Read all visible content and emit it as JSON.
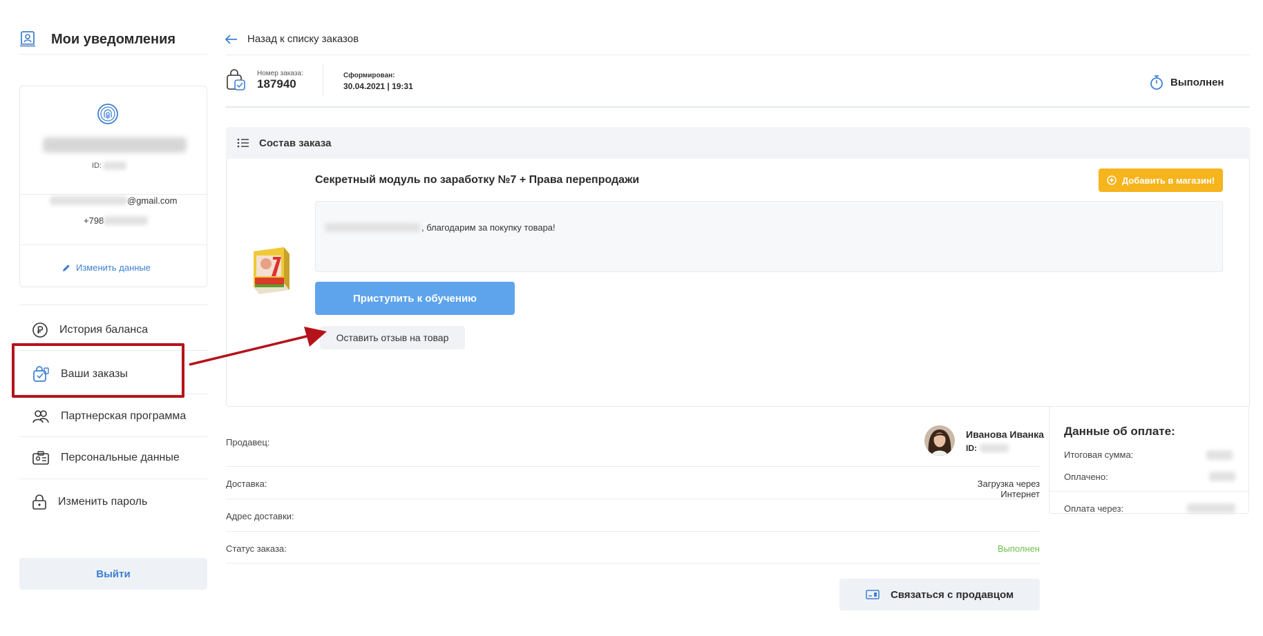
{
  "sidebar": {
    "notifications_title": "Мои уведомления",
    "profile": {
      "id_label": "ID:",
      "email_suffix": "@gmail.com",
      "phone_prefix": "+798",
      "edit_label": "Изменить данные"
    },
    "menu": [
      {
        "label": "История баланса",
        "icon": "ruble-icon"
      },
      {
        "label": "Ваши заказы",
        "icon": "orders-bag-icon"
      },
      {
        "label": "Партнерская программа",
        "icon": "partners-icon"
      },
      {
        "label": "Персональные данные",
        "icon": "id-card-icon"
      },
      {
        "label": "Изменить пароль",
        "icon": "lock-icon"
      }
    ],
    "logout_label": "Выйти"
  },
  "header": {
    "back_label": "Назад к списку заказов",
    "order_number_label": "Номер заказа:",
    "order_number": "187940",
    "created_label": "Сформирован:",
    "created_value": "30.04.2021 | 19:31",
    "status": "Выполнен"
  },
  "order": {
    "section_title": "Состав заказа",
    "product_title": "Секретный модуль по заработку №7 + Права перепродажи",
    "add_to_shop_label": "Добавить в магазин!",
    "thanks_message": ", благодарим за покупку товара!",
    "start_learning_label": "Приступить к обучению",
    "review_label": "Оставить отзыв на товар"
  },
  "details": {
    "seller_label": "Продавец:",
    "seller_name": "Иванова Иванка",
    "seller_id_label": "ID:",
    "delivery_label": "Доставка:",
    "delivery_value": "Загрузка через Интернет",
    "address_label": "Адрес доставки:",
    "status_label": "Статус заказа:",
    "status_value": "Выполнен",
    "contact_label": "Связаться с продавцом"
  },
  "payment": {
    "title": "Данные об оплате:",
    "total_label": "Итоговая сумма:",
    "paid_label": "Оплачено:",
    "via_label": "Оплата через:"
  },
  "colors": {
    "accent_blue": "#5ea4ec",
    "link_blue": "#3d7fd1",
    "orange": "#f6b41d",
    "success_green": "#6cc04a",
    "annotation_red": "#b5131b"
  }
}
